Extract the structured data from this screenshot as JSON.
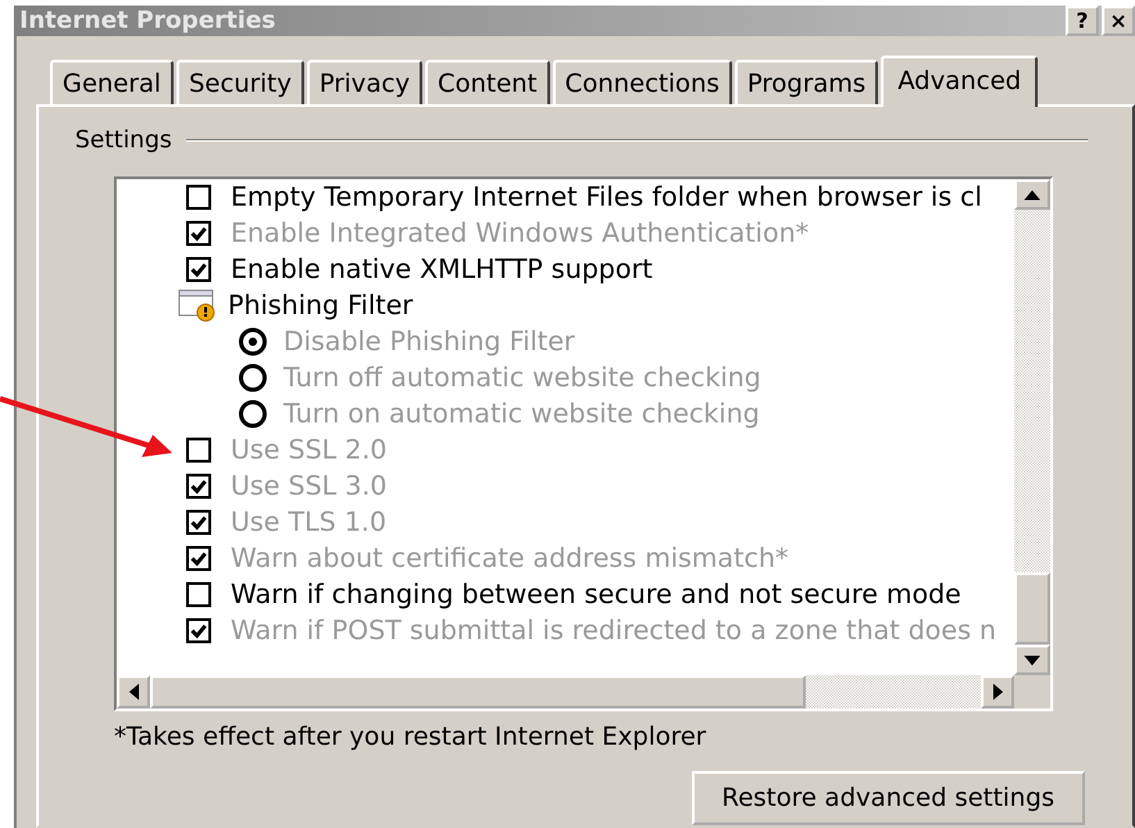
{
  "window": {
    "title": "Internet Properties",
    "buttons": [
      "?",
      "×"
    ]
  },
  "tabs": [
    {
      "label": "General",
      "selected": false
    },
    {
      "label": "Security",
      "selected": false
    },
    {
      "label": "Privacy",
      "selected": false
    },
    {
      "label": "Content",
      "selected": false
    },
    {
      "label": "Connections",
      "selected": false
    },
    {
      "label": "Programs",
      "selected": false
    },
    {
      "label": "Advanced",
      "selected": true
    }
  ],
  "settings": {
    "title": "Settings",
    "items": [
      {
        "kind": "checkbox",
        "label": "Empty Temporary Internet Files folder when browser is cl",
        "checked": false,
        "disabled": false
      },
      {
        "kind": "checkbox",
        "label": "Enable Integrated Windows Authentication*",
        "checked": true,
        "disabled": true
      },
      {
        "kind": "checkbox",
        "label": "Enable native XMLHTTP support",
        "checked": true,
        "disabled": false
      },
      {
        "kind": "group",
        "label": "Phishing Filter",
        "children": [
          {
            "kind": "radio",
            "label": "Disable Phishing Filter",
            "selected": true,
            "disabled": true
          },
          {
            "kind": "radio",
            "label": "Turn off automatic website checking",
            "selected": false,
            "disabled": true
          },
          {
            "kind": "radio",
            "label": "Turn on automatic website checking",
            "selected": false,
            "disabled": true
          }
        ]
      },
      {
        "kind": "checkbox",
        "label": "Use SSL 2.0",
        "checked": false,
        "disabled": true
      },
      {
        "kind": "checkbox",
        "label": "Use SSL 3.0",
        "checked": true,
        "disabled": true
      },
      {
        "kind": "checkbox",
        "label": "Use TLS 1.0",
        "checked": true,
        "disabled": true
      },
      {
        "kind": "checkbox",
        "label": "Warn about certificate address mismatch*",
        "checked": true,
        "disabled": true
      },
      {
        "kind": "checkbox",
        "label": "Warn if changing between secure and not secure mode",
        "checked": false,
        "disabled": false
      },
      {
        "kind": "checkbox",
        "label": "Warn if POST submittal is redirected to a zone that does n",
        "checked": true,
        "disabled": true
      }
    ]
  },
  "note": "*Takes effect after you restart Internet Explorer",
  "buttons": [
    "Restore advanced settings"
  ]
}
